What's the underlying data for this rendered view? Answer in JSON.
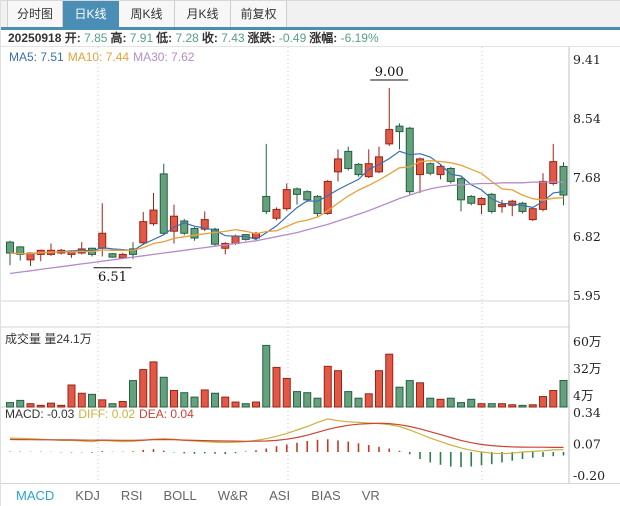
{
  "tab_bar": {
    "tabs": [
      {
        "label": "分时图",
        "active": false
      },
      {
        "label": "日K线",
        "active": true
      },
      {
        "label": "周K线",
        "active": false
      },
      {
        "label": "月K线",
        "active": false
      },
      {
        "label": "前复权",
        "active": false
      }
    ]
  },
  "info_bar": {
    "date": "20250918",
    "fields": [
      {
        "label": "开:",
        "value": "7.85"
      },
      {
        "label": "高:",
        "value": "7.91"
      },
      {
        "label": "低:",
        "value": "7.28"
      },
      {
        "label": "收:",
        "value": "7.43"
      },
      {
        "label": "涨跌:",
        "value": "-0.49"
      },
      {
        "label": "涨幅:",
        "value": "-6.19%"
      }
    ],
    "value_color": "#55A07F"
  },
  "ma_row": {
    "items": [
      {
        "label": "MA5: 7.51",
        "color": "#3A6FB0"
      },
      {
        "label": "MA10: 7.44",
        "color": "#E5A23C"
      },
      {
        "label": "MA30: 7.62",
        "color": "#B48CC8"
      }
    ]
  },
  "volume_header": {
    "title": "成交量",
    "value": "量24.1万"
  },
  "macd_header": {
    "items": [
      {
        "label": "MACD: -0.03",
        "color": "#333333"
      },
      {
        "label": "DIFF: 0.02",
        "color": "#C9B23F"
      },
      {
        "label": "DEA: 0.04",
        "color": "#CC4433"
      }
    ]
  },
  "indicator_tabs": {
    "items": [
      {
        "label": "MACD",
        "active": true
      },
      {
        "label": "KDJ",
        "active": false
      },
      {
        "label": "RSI",
        "active": false
      },
      {
        "label": "BOLL",
        "active": false
      },
      {
        "label": "W&R",
        "active": false
      },
      {
        "label": "ASI",
        "active": false
      },
      {
        "label": "BIAS",
        "active": false
      },
      {
        "label": "VR",
        "active": false
      }
    ]
  },
  "chart_data": {
    "type": "candlestick",
    "panels": [
      "kline",
      "volume",
      "macd"
    ],
    "colors": {
      "up_fill": "#E25847",
      "up_border": "#9A2414",
      "down_fill": "#66A17D",
      "down_border": "#246042",
      "ma5": "#3A6FB0",
      "ma10": "#E5A23C",
      "ma30": "#B48CC8",
      "diff_line": "#C9B23F",
      "dea_line": "#CC4433",
      "hist_up": "#C03A28",
      "hist_down": "#2E7D4F",
      "grid": "#c9c9c9",
      "border": "#d5d5d5",
      "axis_text": "#222222"
    },
    "kline": {
      "y_axis_labels": [
        "9.41",
        "8.54",
        "7.68",
        "6.82",
        "5.95"
      ],
      "y_max": 9.41,
      "y_min": 5.95,
      "annotations": [
        {
          "label": "9.00",
          "candle_index": 37,
          "type": "high"
        },
        {
          "label": "6.51",
          "candle_index": 10,
          "type": "low"
        }
      ],
      "candles": [
        [
          6.74,
          6.76,
          6.4,
          6.58
        ],
        [
          6.67,
          6.68,
          6.47,
          6.56
        ],
        [
          6.48,
          6.59,
          6.39,
          6.58
        ],
        [
          6.56,
          6.63,
          6.46,
          6.62
        ],
        [
          6.56,
          6.72,
          6.54,
          6.62
        ],
        [
          6.58,
          6.64,
          6.56,
          6.62
        ],
        [
          6.56,
          6.62,
          6.51,
          6.61
        ],
        [
          6.58,
          6.74,
          6.56,
          6.64
        ],
        [
          6.65,
          6.66,
          6.53,
          6.56
        ],
        [
          6.65,
          7.31,
          6.53,
          6.87
        ],
        [
          6.57,
          6.58,
          6.51,
          6.52
        ],
        [
          6.51,
          6.58,
          6.51,
          6.56
        ],
        [
          6.64,
          6.74,
          6.49,
          6.56
        ],
        [
          6.73,
          7.18,
          6.7,
          7.04
        ],
        [
          7.01,
          7.46,
          6.98,
          7.21
        ],
        [
          7.74,
          7.89,
          6.85,
          6.87
        ],
        [
          6.9,
          7.29,
          6.72,
          7.12
        ],
        [
          7.05,
          7.08,
          6.84,
          6.87
        ],
        [
          6.94,
          6.96,
          6.76,
          6.8
        ],
        [
          6.93,
          7.19,
          6.9,
          7.07
        ],
        [
          6.93,
          6.95,
          6.68,
          6.71
        ],
        [
          6.65,
          6.74,
          6.56,
          6.72
        ],
        [
          6.72,
          6.85,
          6.7,
          6.83
        ],
        [
          6.85,
          6.86,
          6.76,
          6.78
        ],
        [
          6.8,
          6.89,
          6.78,
          6.87
        ],
        [
          7.41,
          8.18,
          7.15,
          7.19
        ],
        [
          7.09,
          7.25,
          7.06,
          7.22
        ],
        [
          7.23,
          7.6,
          7.2,
          7.51
        ],
        [
          7.52,
          7.54,
          7.29,
          7.44
        ],
        [
          7.48,
          7.5,
          7.33,
          7.36
        ],
        [
          7.41,
          7.43,
          7.12,
          7.16
        ],
        [
          7.16,
          7.65,
          7.14,
          7.63
        ],
        [
          7.77,
          8.1,
          7.63,
          7.96
        ],
        [
          8.07,
          8.14,
          7.79,
          7.82
        ],
        [
          7.88,
          7.9,
          7.7,
          7.73
        ],
        [
          7.7,
          8.1,
          7.68,
          7.89
        ],
        [
          7.77,
          8.14,
          7.75,
          7.99
        ],
        [
          8.18,
          9.0,
          8.15,
          8.39
        ],
        [
          8.44,
          8.48,
          8.1,
          8.36
        ],
        [
          8.41,
          8.43,
          7.44,
          7.48
        ],
        [
          7.73,
          7.98,
          7.46,
          7.96
        ],
        [
          7.89,
          7.91,
          7.72,
          7.75
        ],
        [
          7.73,
          7.87,
          7.66,
          7.85
        ],
        [
          7.82,
          7.84,
          7.6,
          7.63
        ],
        [
          7.67,
          7.69,
          7.19,
          7.36
        ],
        [
          7.41,
          7.43,
          7.28,
          7.31
        ],
        [
          7.29,
          7.4,
          7.15,
          7.38
        ],
        [
          7.44,
          7.46,
          7.16,
          7.19
        ],
        [
          7.26,
          7.36,
          7.17,
          7.29
        ],
        [
          7.28,
          7.36,
          7.12,
          7.34
        ],
        [
          7.31,
          7.33,
          7.16,
          7.19
        ],
        [
          7.07,
          7.25,
          7.05,
          7.23
        ],
        [
          7.22,
          7.75,
          7.19,
          7.63
        ],
        [
          7.6,
          8.18,
          7.57,
          7.92
        ],
        [
          7.85,
          7.91,
          7.28,
          7.43
        ]
      ],
      "ma30_values": [
        6.28,
        6.3,
        6.32,
        6.34,
        6.36,
        6.38,
        6.4,
        6.42,
        6.44,
        6.46,
        6.48,
        6.5,
        6.52,
        6.54,
        6.56,
        6.58,
        6.6,
        6.62,
        6.64,
        6.66,
        6.68,
        6.7,
        6.72,
        6.74,
        6.76,
        6.79,
        6.82,
        6.85,
        6.88,
        6.92,
        6.96,
        7.0,
        7.05,
        7.1,
        7.15,
        7.2,
        7.26,
        7.32,
        7.38,
        7.43,
        7.48,
        7.52,
        7.55,
        7.57,
        7.58,
        7.59,
        7.6,
        7.6,
        7.61,
        7.61,
        7.61,
        7.62,
        7.62,
        7.62,
        7.62
      ]
    },
    "volume": {
      "y_axis_labels": [
        "60万",
        "32万",
        "4万"
      ],
      "unit": "万",
      "values_wan": [
        4,
        6,
        3,
        1.5,
        3.5,
        1.5,
        20,
        12.5,
        11.5,
        6.5,
        3,
        5,
        24,
        34,
        41,
        27,
        15,
        13,
        9,
        15.5,
        12.5,
        9,
        4.5,
        3,
        4.5,
        56,
        36,
        26,
        14,
        13,
        8,
        37,
        33,
        14,
        8,
        12,
        33,
        48,
        18,
        24,
        22,
        8,
        7,
        8,
        4,
        7,
        3,
        3,
        3,
        2,
        1.5,
        2,
        9.5,
        15,
        24.1
      ],
      "last_value_label": "24.1万"
    },
    "macd": {
      "y_axis_labels": [
        "0.34",
        "0.07",
        "-0.20"
      ],
      "y_max": 0.34,
      "y_min": -0.2,
      "diff": [
        0.12,
        0.118,
        0.115,
        0.11,
        0.105,
        0.1,
        0.1,
        0.095,
        0.09,
        0.1,
        0.095,
        0.09,
        0.092,
        0.1,
        0.11,
        0.115,
        0.11,
        0.1,
        0.095,
        0.09,
        0.085,
        0.082,
        0.085,
        0.09,
        0.1,
        0.115,
        0.135,
        0.16,
        0.19,
        0.22,
        0.255,
        0.285,
        0.27,
        0.26,
        0.255,
        0.25,
        0.245,
        0.235,
        0.22,
        0.19,
        0.155,
        0.12,
        0.09,
        0.06,
        0.035,
        0.015,
        0.0,
        -0.01,
        -0.015,
        -0.01,
        0.0,
        0.005,
        0.01,
        0.018,
        0.02
      ],
      "dea": [
        0.108,
        0.107,
        0.106,
        0.105,
        0.105,
        0.104,
        0.104,
        0.103,
        0.102,
        0.103,
        0.102,
        0.101,
        0.101,
        0.103,
        0.106,
        0.108,
        0.106,
        0.103,
        0.1,
        0.098,
        0.096,
        0.095,
        0.094,
        0.092,
        0.093,
        0.095,
        0.1,
        0.11,
        0.125,
        0.145,
        0.17,
        0.195,
        0.215,
        0.23,
        0.24,
        0.245,
        0.248,
        0.245,
        0.235,
        0.22,
        0.2,
        0.175,
        0.15,
        0.125,
        0.1,
        0.08,
        0.065,
        0.055,
        0.048,
        0.044,
        0.042,
        0.041,
        0.041,
        0.04,
        0.04
      ],
      "hist": [
        0.004,
        0.003,
        0.002,
        0.003,
        0.002,
        -0.003,
        -0.004,
        -0.003,
        -0.006,
        0.008,
        0.002,
        0.003,
        0.006,
        0.018,
        0.025,
        0.012,
        -0.004,
        -0.012,
        -0.015,
        -0.012,
        -0.015,
        -0.018,
        -0.01,
        0.005,
        0.015,
        0.03,
        0.05,
        0.065,
        0.08,
        0.095,
        0.105,
        0.11,
        0.1,
        0.09,
        0.075,
        0.06,
        0.045,
        0.03,
        0.01,
        -0.02,
        -0.06,
        -0.09,
        -0.11,
        -0.125,
        -0.13,
        -0.125,
        -0.115,
        -0.105,
        -0.09,
        -0.075,
        -0.06,
        -0.05,
        -0.042,
        -0.036,
        -0.03
      ]
    }
  }
}
